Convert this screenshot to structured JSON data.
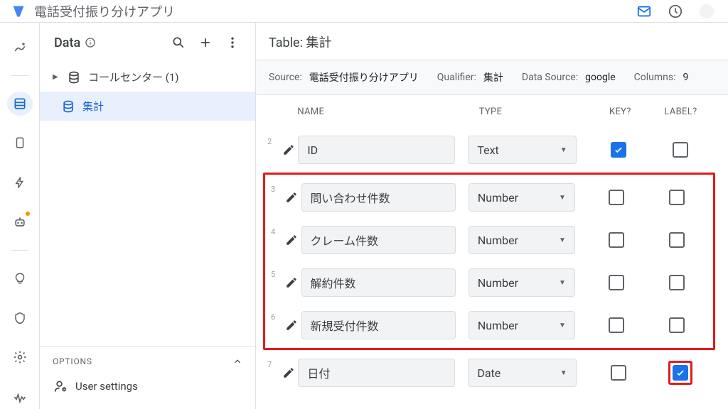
{
  "topbar": {
    "title": "電話受付振り分けアプリ"
  },
  "panel": {
    "title": "Data",
    "tree": {
      "root_label": "コールセンター (1)",
      "child_label": "集計"
    },
    "options": {
      "header": "OPTIONS",
      "user_settings": "User settings"
    }
  },
  "main": {
    "title_prefix": "Table: ",
    "title_value": "集計",
    "meta": {
      "source_label": "Source:",
      "source_value": "電話受付振り分けアプリ",
      "qualifier_label": "Qualifier:",
      "qualifier_value": "集計",
      "datasource_label": "Data Source:",
      "datasource_value": "google",
      "columns_label": "Columns:",
      "columns_value": "9"
    },
    "headers": {
      "name": "NAME",
      "type": "TYPE",
      "key": "KEY?",
      "label": "LABEL?"
    },
    "rows": [
      {
        "num": "2",
        "name": "ID",
        "type": "Text",
        "key": true,
        "label": false,
        "hl": false
      },
      {
        "num": "3",
        "name": "問い合わせ件数",
        "type": "Number",
        "key": false,
        "label": false,
        "hl": true
      },
      {
        "num": "4",
        "name": "クレーム件数",
        "type": "Number",
        "key": false,
        "label": false,
        "hl": true
      },
      {
        "num": "5",
        "name": "解約件数",
        "type": "Number",
        "key": false,
        "label": false,
        "hl": true
      },
      {
        "num": "6",
        "name": "新規受付件数",
        "type": "Number",
        "key": false,
        "label": false,
        "hl": true
      },
      {
        "num": "7",
        "name": "日付",
        "type": "Date",
        "key": false,
        "label": true,
        "hl": false,
        "label_hl": true
      }
    ]
  }
}
